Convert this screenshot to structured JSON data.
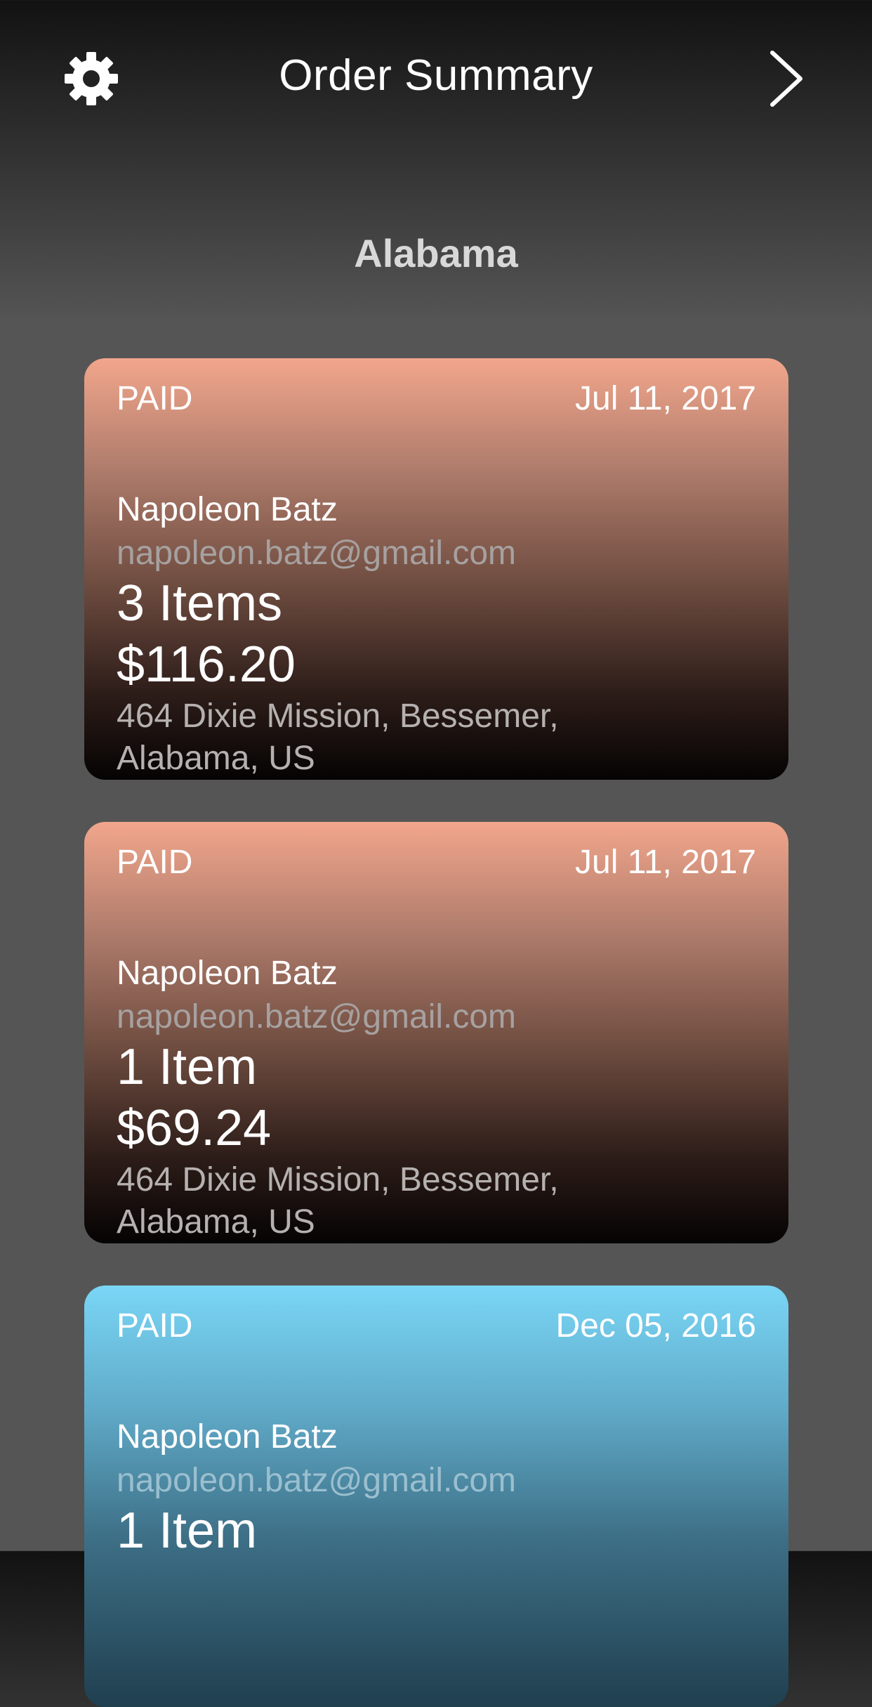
{
  "header": {
    "title": "Order Summary",
    "settings_icon": "gear-icon",
    "next_icon": "chevron-right-icon"
  },
  "section": {
    "title": "Alabama"
  },
  "orders": [
    {
      "status": "PAID",
      "date": "Jul 11, 2017",
      "name": "Napoleon Batz",
      "email": "napoleon.batz@gmail.com",
      "items": "3 Items",
      "total": "$116.20",
      "address_line1": "464 Dixie Mission, Bessemer,",
      "address_line2": "Alabama, US",
      "theme": "peach"
    },
    {
      "status": "PAID",
      "date": "Jul 11, 2017",
      "name": "Napoleon Batz",
      "email": "napoleon.batz@gmail.com",
      "items": "1 Item",
      "total": "$69.24",
      "address_line1": "464 Dixie Mission, Bessemer,",
      "address_line2": "Alabama, US",
      "theme": "peach"
    },
    {
      "status": "PAID",
      "date": "Dec 05, 2016",
      "name": "Napoleon Batz",
      "email": "napoleon.batz@gmail.com",
      "items": "1 Item",
      "theme": "blue"
    }
  ],
  "colors": {
    "peach_top": "#f2a68c",
    "blue_top": "#7ad6f6",
    "background": "#555555"
  }
}
